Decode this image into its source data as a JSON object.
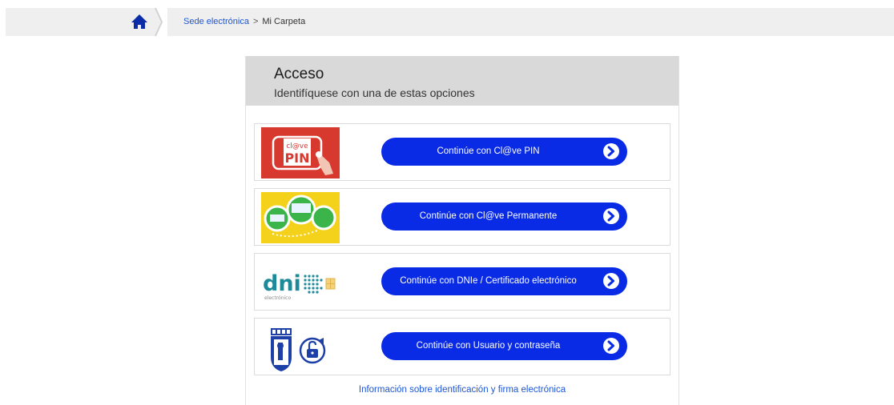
{
  "breadcrumb": {
    "home_icon": "home-icon",
    "items": [
      "Sede electrónica",
      "Mi Carpeta"
    ],
    "separator": ">"
  },
  "panel": {
    "title": "Acceso",
    "subtitle": "Identifíquese con una de estas opciones"
  },
  "options": [
    {
      "logo_text_top": "cl@ve",
      "logo_text_main": "PIN",
      "button": "Continúe con Cl@ve PIN"
    },
    {
      "button": "Continúe con Cl@ve Permanente"
    },
    {
      "logo_text_main": "dni",
      "logo_text_sub": "electrónico",
      "button": "Continúe con DNIe / Certificado electrónico"
    },
    {
      "button": "Continúe con Usuario y contraseña"
    }
  ],
  "footer_link": "Información sobre identificación y firma electrónica",
  "colors": {
    "button": "#0a2be6",
    "link": "#1d56d6",
    "header_bg": "#d9d9d9",
    "clave_red": "#d8392f",
    "clave_yellow": "#f4d21b"
  }
}
